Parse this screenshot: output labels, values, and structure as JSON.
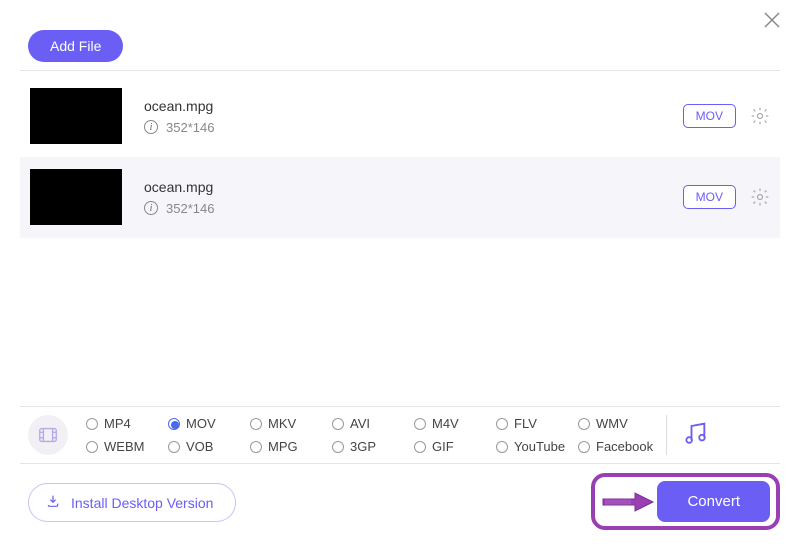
{
  "header": {
    "add_file_label": "Add File"
  },
  "files": [
    {
      "name": "ocean.mpg",
      "dimensions": "352*146",
      "format": "MOV"
    },
    {
      "name": "ocean.mpg",
      "dimensions": "352*146",
      "format": "MOV"
    }
  ],
  "formats": {
    "row1": [
      "MP4",
      "MOV",
      "MKV",
      "AVI",
      "M4V",
      "FLV",
      "WMV"
    ],
    "row2": [
      "WEBM",
      "VOB",
      "MPG",
      "3GP",
      "GIF",
      "YouTube",
      "Facebook"
    ],
    "selected": "MOV"
  },
  "footer": {
    "install_label": "Install Desktop Version",
    "convert_label": "Convert"
  }
}
